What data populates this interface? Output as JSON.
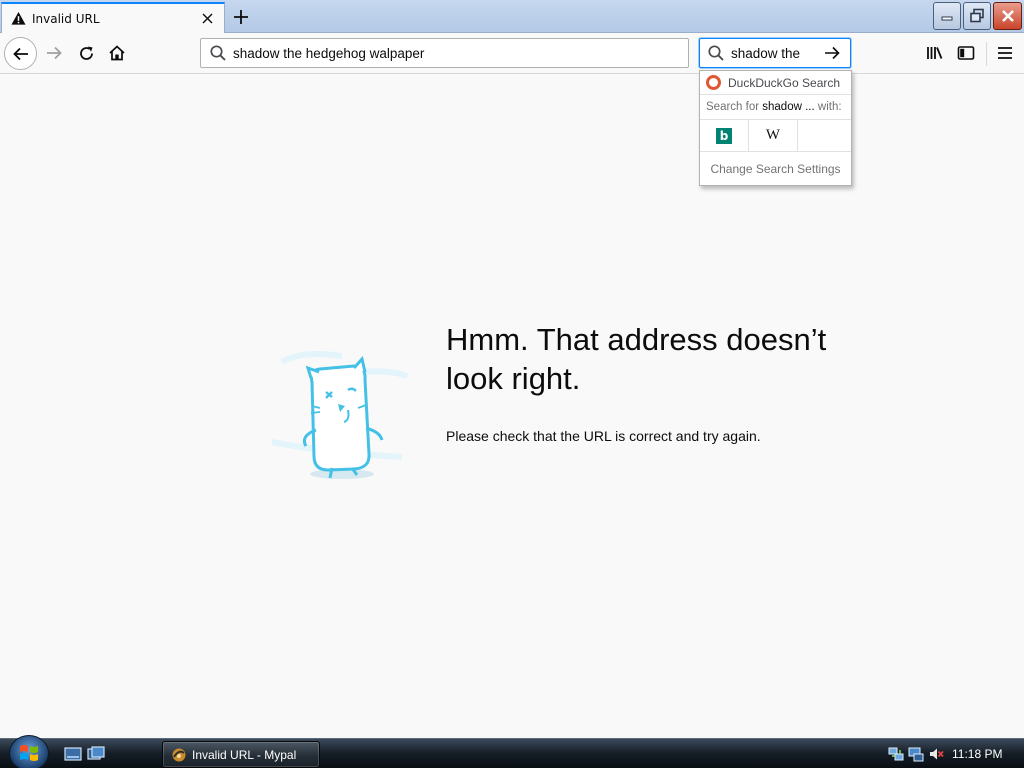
{
  "browser": {
    "tab": {
      "title": "Invalid URL",
      "icon": "warning-icon"
    },
    "url_bar": {
      "value": "shadow the hedgehog walpaper"
    },
    "search_bar": {
      "value": "shadow the"
    }
  },
  "search_popup": {
    "engine_label": "DuckDuckGo Search",
    "search_for_prefix": "Search for",
    "search_for_term": "shadow ...",
    "search_for_suffix": "with:",
    "alt_engines": [
      "bing-icon",
      "wikipedia-icon"
    ],
    "wiki_glyph": "W",
    "bing_glyph": "b",
    "settings_label": "Change Search Settings"
  },
  "error_page": {
    "title": "Hmm. That address doesn’t look right.",
    "message": "Please check that the URL is correct and try again."
  },
  "taskbar": {
    "window_button": "Invalid URL - Mypal",
    "clock": "11:18 PM"
  },
  "colors": {
    "accent": "#0a84ff",
    "page_background": "#f9f9fa",
    "illustration": "#45c0e6"
  }
}
